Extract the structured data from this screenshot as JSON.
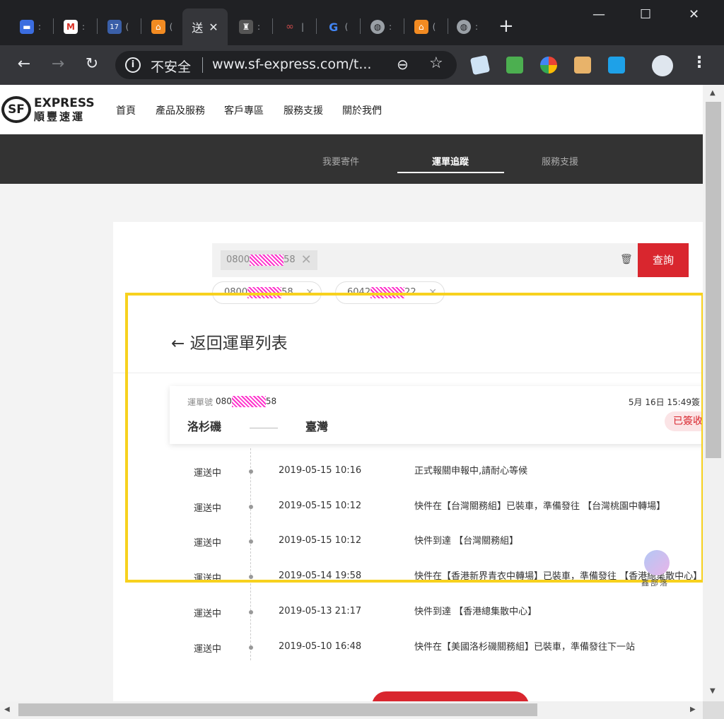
{
  "browser": {
    "tabs": [
      {
        "icon": "chat-icon",
        "dots": ":",
        "color": "#3b6de0"
      },
      {
        "icon": "gmail-icon",
        "dots": ":",
        "color": "#ffffff"
      },
      {
        "icon": "calendar-icon",
        "label": "17",
        "dots": "(",
        "color": "#3a5fa8"
      },
      {
        "icon": "home-icon",
        "dots": "(",
        "color": "#f28b22"
      },
      {
        "icon": "sf-tab-icon",
        "label": "送",
        "close": "✕",
        "active": true
      },
      {
        "icon": "castle-icon",
        "dots": ":",
        "color": "#777777"
      },
      {
        "icon": "link-icon",
        "dots": "|",
        "color": "#c94a4a"
      },
      {
        "icon": "google-icon",
        "dots": "(",
        "color": "#4285f4"
      },
      {
        "icon": "globe-icon",
        "dots": ":",
        "color": "#9aa0a6"
      },
      {
        "icon": "home-icon",
        "dots": "(",
        "color": "#f28b22"
      },
      {
        "icon": "globe-icon",
        "dots": ":",
        "color": "#9aa0a6"
      }
    ],
    "new_tab": "+",
    "window_controls": {
      "minimize": "—",
      "maximize": "☐",
      "close": "✕"
    },
    "back": "←",
    "forward": "→",
    "reload": "↻",
    "info_icon": "i",
    "insecure_label": "不安全",
    "url": "www.sf-express.com/t...",
    "zoom_icon": "⊖",
    "bookmark_icon": "☆",
    "menu": "⋮"
  },
  "site": {
    "logo_mark": "SF",
    "logo_express": "EXPRESS",
    "logo_cn": "順豐速運",
    "nav": [
      "首頁",
      "產品及服務",
      "客戶專區",
      "服務支援",
      "關於我們"
    ],
    "subnav": [
      {
        "label": "我要寄件"
      },
      {
        "label": "運單追蹤",
        "active": true
      },
      {
        "label": "服務支援"
      }
    ]
  },
  "search": {
    "chip_prefix": "0800",
    "chip_suffix": "58",
    "chip_close": "✕",
    "trash_icon": "🗑",
    "query_label": "查詢",
    "history": [
      {
        "prefix": "0800",
        "suffix": "58",
        "close": "✕"
      },
      {
        "prefix": "6042",
        "suffix": "22",
        "close": "✕"
      }
    ]
  },
  "back_link": {
    "arrow": "←",
    "label": "返回運單列表"
  },
  "waybill": {
    "label": "運單號",
    "number_prefix": "080",
    "number_suffix": "58",
    "date": "5月 16日 15:49簽",
    "from": "洛杉磯",
    "to": "臺灣",
    "status": "已簽收"
  },
  "events": [
    {
      "status": "運送中",
      "time": "2019-05-15 10:16",
      "desc": "正式報關申報中,請耐心等候"
    },
    {
      "status": "運送中",
      "time": "2019-05-15 10:12",
      "desc": "快件在【台灣關務組】已裝車，準備發往 【台灣桃園中轉場】"
    },
    {
      "status": "運送中",
      "time": "2019-05-15 10:12",
      "desc": "快件到達 【台灣關務組】"
    },
    {
      "status": "運送中",
      "time": "2019-05-14 19:58",
      "desc": "快件在【香港新界青衣中轉場】已裝車，準備發往 【香港總集散中心】"
    },
    {
      "status": "運送中",
      "time": "2019-05-13 21:17",
      "desc": "快件到達 【香港總集散中心】"
    },
    {
      "status": "運送中",
      "time": "2019-05-10 16:48",
      "desc": "快件在【美國洛杉磯關務組】已裝車，準備發往下一站"
    }
  ],
  "watermark": {
    "text": "鑫部落"
  },
  "scrollbar": {
    "up": "▲",
    "down": "▼",
    "left": "◀",
    "right": "▶"
  },
  "colors": {
    "brand_red": "#d9262e",
    "highlight": "#f7d11e",
    "header_dark": "#333333"
  }
}
